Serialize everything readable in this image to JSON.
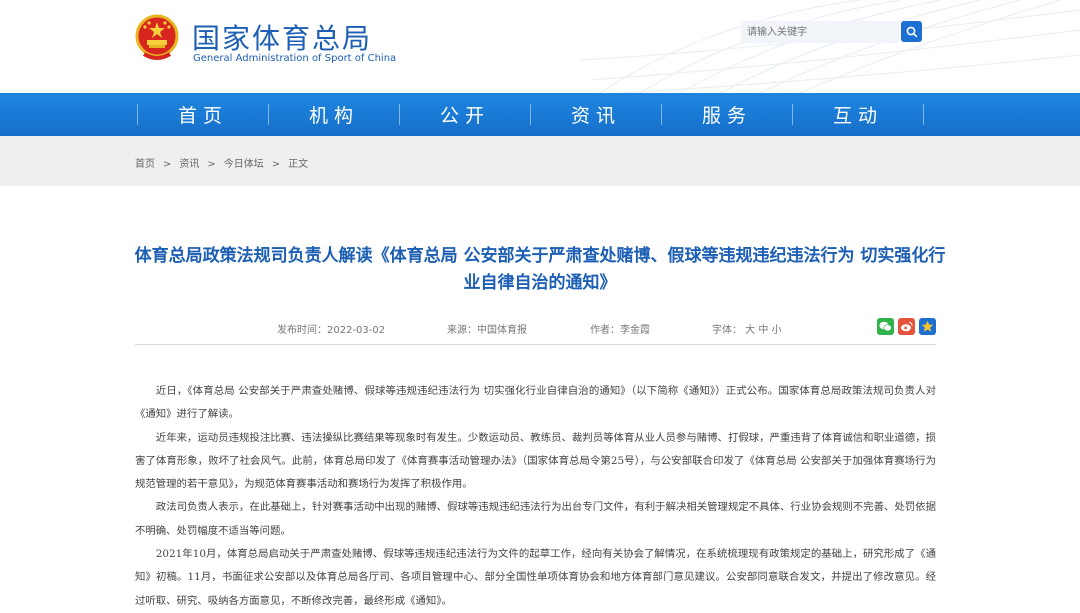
{
  "header": {
    "logo_cn": "国家体育总局",
    "logo_en": "General Administration of Sport of China",
    "search_placeholder": "请输入关键字"
  },
  "nav": {
    "items": [
      "首页",
      "机构",
      "公开",
      "资讯",
      "服务",
      "互动"
    ]
  },
  "breadcrumb": {
    "items": [
      "首页",
      "资讯",
      "今日体坛",
      "正文"
    ],
    "separator": ">"
  },
  "article": {
    "title": "体育总局政策法规司负责人解读《体育总局 公安部关于严肃查处赌博、假球等违规违纪违法行为 切实强化行业自律自治的通知》",
    "meta": {
      "date": "发布时间：2022-03-02",
      "source": "来源：中国体育报",
      "author": "作者：李金霞",
      "fontsize": "字体： 大 中 小"
    },
    "share_icons": [
      "wechat-icon",
      "weibo-icon",
      "favorite-icon"
    ],
    "paragraphs": [
      "近日，《体育总局 公安部关于严肃查处赌博、假球等违规违纪违法行为 切实强化行业自律自治的通知》（以下简称《通知》）正式公布。国家体育总局政策法规司负责人对《通知》进行了解读。",
      "近年来，运动员违规投注比赛、违法操纵比赛结果等现象时有发生。少数运动员、教练员、裁判员等体育从业人员参与赌博、打假球，严重违背了体育诚信和职业道德，损害了体育形象，败坏了社会风气。此前，体育总局印发了《体育赛事活动管理办法》（国家体育总局令第25号），与公安部联合印发了《体育总局 公安部关于加强体育赛场行为规范管理的若干意见》，为规范体育赛事活动和赛场行为发挥了积极作用。",
      "政法司负责人表示，在此基础上，针对赛事活动中出现的赌博、假球等违规违纪违法行为出台专门文件，有利于解决相关管理规定不具体、行业协会规则不完善、处罚依据不明确、处罚幅度不适当等问题。",
      "2021年10月，体育总局启动关于严肃查处赌博、假球等违规违纪违法行为文件的起草工作，经向有关协会了解情况，在系统梳理现有政策规定的基础上，研究形成了《通知》初稿。11月，书面征求公安部以及体育总局各厅司、各项目管理中心、部分全国性单项体育协会和地方体育部门意见建议。公安部同意联合发文，并提出了修改意见。经过听取、研究、吸纳各方面意见，不断修改完善，最终形成《通知》。"
    ]
  },
  "colors": {
    "brand_blue": "#1d5fb4",
    "nav_blue": "#1a7ad6",
    "breadcrumb_bg": "#efefef",
    "wechat": "#2fb34a",
    "weibo": "#e5533b",
    "favorite": "#f5a623"
  }
}
